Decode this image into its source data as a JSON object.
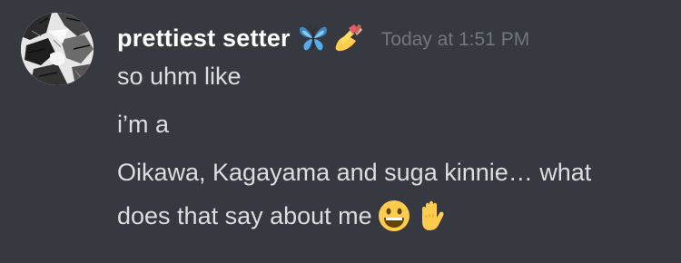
{
  "message": {
    "author": "prettiest setter",
    "author_badges": [
      "butterfly-emoji",
      "nail-polish-emoji"
    ],
    "timestamp": "Today at 1:51 PM",
    "lines": [
      "so uhm like",
      "i’m a",
      "Oikawa, Kagayama and suga kinnie… what",
      "does that say about me"
    ],
    "trailing_emojis": [
      "grinning-face-emoji",
      "raised-hand-emoji"
    ]
  },
  "colors": {
    "background": "#36393f",
    "username": "#ffffff",
    "message_text": "#dcddde",
    "timestamp": "#72767d"
  }
}
